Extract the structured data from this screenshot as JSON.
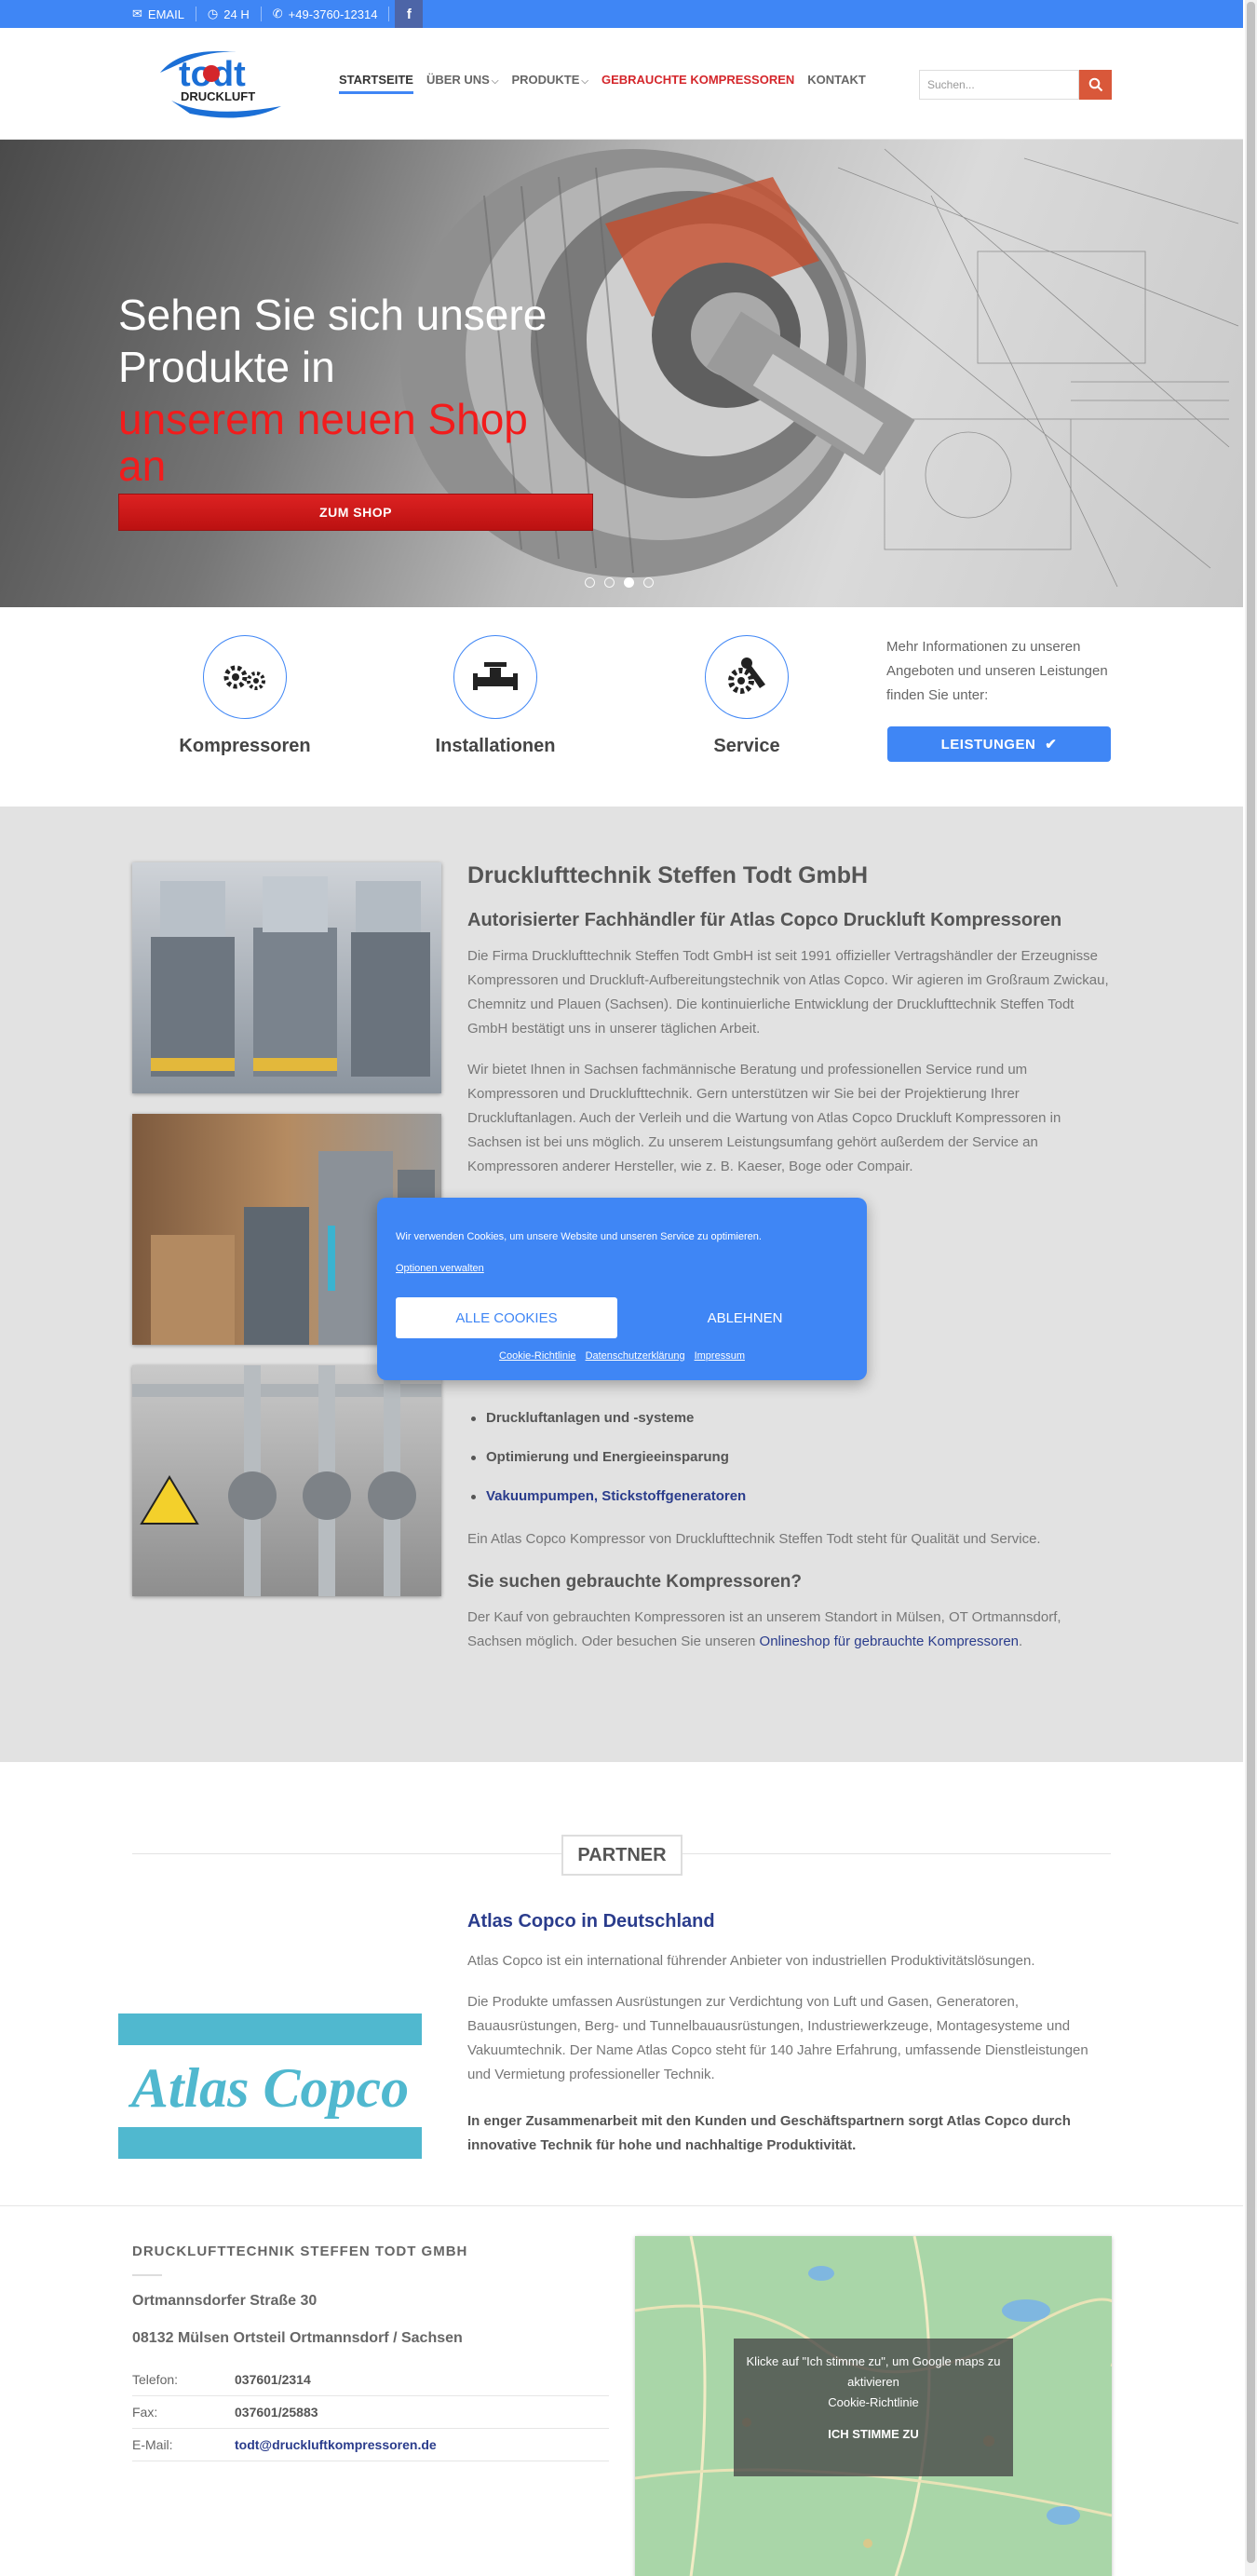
{
  "topbar": {
    "email": "EMAIL",
    "hours": "24 H",
    "phone": "+49-3760-12314",
    "facebook": "f"
  },
  "header": {
    "logo_text": "todt",
    "logo_sub": "DRUCKLUFT",
    "nav": [
      "STARTSEITE",
      "ÜBER UNS",
      "PRODUKTE",
      "GEBRAUCHTE KOMPRESSOREN",
      "KONTAKT"
    ],
    "search_placeholder": "Suchen..."
  },
  "hero": {
    "line1": "Sehen Sie sich unsere",
    "line2": "Produkte in",
    "line3": "unserem neuen Shop",
    "line4": "an",
    "button": "ZUM SHOP",
    "slides": 4,
    "active_slide": 3
  },
  "features": {
    "items": [
      {
        "label": "Kompressoren",
        "icon": "gears-icon"
      },
      {
        "label": "Installationen",
        "icon": "pipe-valve-icon"
      },
      {
        "label": "Service",
        "icon": "wrench-gear-icon"
      }
    ],
    "info": "Mehr Informationen zu unseren Angeboten und unseren Leistungen finden Sie unter:",
    "button": "LEISTUNGEN"
  },
  "about": {
    "title": "Drucklufttechnik Steffen Todt GmbH",
    "subtitle": "Autorisierter Fachhändler für Atlas Copco Druckluft Kompressoren",
    "p1": "Die Firma Drucklufttechnik Steffen Todt GmbH ist seit 1991 offizieller Vertragshändler der Erzeugnisse Kompressoren und Druckluft-Aufbereitungstechnik von Atlas Copco. Wir agieren im Großraum Zwickau, Chemnitz und Plauen (Sachsen). Die kontinuierliche Entwicklung der Drucklufttechnik Steffen Todt GmbH bestätigt uns in unserer täglichen Arbeit.",
    "p2": "Wir bietet Ihnen in Sachsen fachmännische Beratung und professionellen Service rund um Kompressoren und Drucklufttechnik. Gern unterstützen wir Sie bei der Projektierung Ihrer Druckluftanlagen. Auch der Verleih und die Wartung von Atlas Copco Druckluft Kompressoren in Sachsen ist bei uns möglich. Zu unserem Leistungsumfang gehört außerdem der Service an Kompressoren anderer Hersteller, wie z. B. Kaeser, Boge oder Compair.",
    "list": [
      "Druckluftanlagen und -systeme",
      "Optimierung und Energieeinsparung",
      "Vakuumpumpen, Stickstoffgeneratoren"
    ],
    "p3": "Ein Atlas Copco Kompressor von Drucklufttechnik Steffen Todt steht für Qualität und Service.",
    "h_used": "Sie suchen gebrauchte Kompressoren?",
    "p4_text": "Der Kauf von gebrauchten Kompressoren ist an unserem Standort in Mülsen, OT Ortmannsdorf, Sachsen möglich. Oder besuchen Sie unseren",
    "p4_link": "Onlineshop für gebrauchte Kompressoren",
    "p4_end": "."
  },
  "cookie": {
    "message": "Wir verwenden Cookies, um unsere Website und unseren Service zu optimieren.",
    "options": "Optionen verwalten",
    "accept": "ALLE COOKIES",
    "decline": "ABLEHNEN",
    "links": [
      "Cookie-Richtlinie",
      "Datenschutzerklärung",
      "Impressum"
    ]
  },
  "partner": {
    "heading": "PARTNER",
    "logo_text": "Atlas Copco",
    "title": "Atlas Copco in Deutschland",
    "p1": "Atlas Copco ist ein international führender Anbieter von industriellen Produktivitätslösungen.",
    "p2": "Die Produkte umfassen Ausrüstungen zur Verdichtung von Luft und Gasen, Generatoren, Bauausrüstungen, Berg- und Tunnelbauausrüstungen, Industriewerkzeuge, Montagesysteme und Vakuumtechnik. Der Name Atlas Copco steht für 140 Jahre Erfahrung,  umfassende Dienstleistungen und Vermietung professioneller Technik.",
    "p3": "In enger Zusammenarbeit mit den Kunden und Geschäftspartnern sorgt Atlas Copco durch innovative Technik für hohe und nachhaltige Produktivität."
  },
  "footer": {
    "company": "DRUCKLUFTTECHNIK STEFFEN TODT GMBH",
    "street": "Ortmannsdorfer Straße 30",
    "city": "08132 Mülsen Ortsteil Ortmannsdorf / Sachsen",
    "contacts": [
      {
        "k": "Telefon:",
        "v": "037601/2314"
      },
      {
        "k": "Fax:",
        "v": "037601/25883"
      },
      {
        "k": "E-Mail:",
        "v": "todt@druckluftkompressoren.de"
      }
    ],
    "map_text1": "Klicke auf \"Ich stimme zu\", um Google maps zu aktivieren",
    "map_link": "Cookie-Richtlinie",
    "map_button": "ICH STIMME ZU"
  },
  "colors": {
    "accent": "#3f86f5",
    "red": "#d4262b",
    "dark_blue": "#2a3c8c"
  }
}
